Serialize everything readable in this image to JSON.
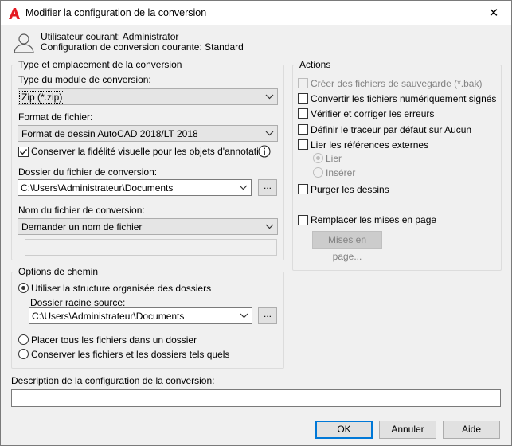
{
  "window": {
    "title": "Modifier la configuration de la conversion",
    "close_glyph": "✕",
    "app_icon": "autocad-logo-icon"
  },
  "header": {
    "user_label": "Utilisateur courant: Administrator",
    "config_label": "Configuration de conversion courante: Standard",
    "icon": "user-icon"
  },
  "type_group": {
    "title": "Type et emplacement de la conversion",
    "module_label": "Type du module de conversion:",
    "module_value": "Zip (*.zip)",
    "format_label": "Format de fichier:",
    "format_value": "Format de dessin AutoCAD 2018/LT 2018",
    "fidelity_label": "Conserver la fidélité visuelle pour les objets d'annotation",
    "fidelity_checked": true,
    "folder_label": "Dossier du fichier de conversion:",
    "folder_value": "C:\\Users\\Administrateur\\Documents",
    "browse_label": "...",
    "filename_label": "Nom du fichier de conversion:",
    "filename_value": "Demander un nom de fichier",
    "filename_text": ""
  },
  "actions_group": {
    "title": "Actions",
    "backup_label": "Créer des fichiers de sauvegarde (*.bak)",
    "convert_signed_label": "Convertir les fichiers numériquement signés",
    "audit_label": "Vérifier et corriger les erreurs",
    "plotter_label": "Définir le traceur par défaut sur Aucun",
    "bind_xrefs_label": "Lier les références externes",
    "bind_label": "Lier",
    "insert_label": "Insérer",
    "purge_label": "Purger les dessins",
    "replace_layouts_label": "Remplacer les mises en page",
    "layouts_button": "Mises en page..."
  },
  "path_group": {
    "title": "Options de chemin",
    "organized_label": "Utiliser la structure organisée des dossiers",
    "source_root_label": "Dossier racine source:",
    "source_root_value": "C:\\Users\\Administrateur\\Documents",
    "browse_label": "...",
    "single_folder_label": "Placer tous les fichiers dans un dossier",
    "keep_as_is_label": "Conserver les fichiers et les dossiers tels quels"
  },
  "description": {
    "label": "Description de la configuration de la conversion:",
    "value": ""
  },
  "buttons": {
    "ok": "OK",
    "cancel": "Annuler",
    "help": "Aide"
  },
  "colors": {
    "accent": "#0078d7",
    "autocad_red": "#e51b23",
    "disabled_text": "#838383"
  }
}
